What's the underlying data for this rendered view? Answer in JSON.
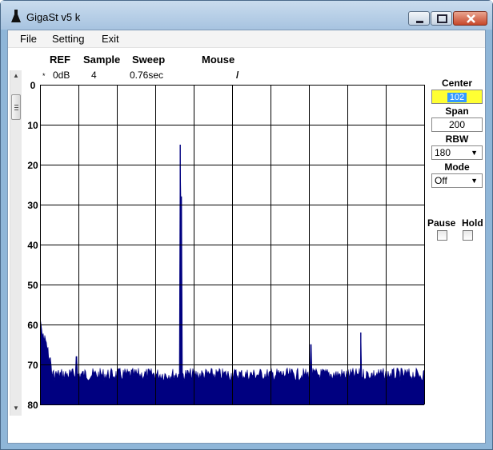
{
  "window": {
    "title": "GigaSt v5 k"
  },
  "menu": [
    "File",
    "Setting",
    "Exit"
  ],
  "header": {
    "ref_label": "REF",
    "sample_label": "Sample",
    "sweep_label": "Sweep",
    "mouse_label": "Mouse",
    "ref_marker": "*",
    "ref_value": "0dB",
    "sample_value": "4",
    "sweep_value": "0.76sec",
    "mouse_value": "/"
  },
  "y_axis": {
    "labels": [
      "0",
      "10",
      "20",
      "30",
      "40",
      "50",
      "60",
      "70",
      "80"
    ]
  },
  "controls": {
    "center_label": "Center",
    "center_value": "102",
    "span_label": "Span",
    "span_value": "200",
    "rbw_label": "RBW",
    "rbw_value": "180",
    "mode_label": "Mode",
    "mode_value": "Off",
    "pause_label": "Pause",
    "hold_label": "Hold"
  },
  "chart_data": {
    "type": "line",
    "ylim": [
      0,
      80
    ],
    "y_inverted": true,
    "xlim": [
      2,
      202
    ],
    "grid": true,
    "vertical_divisions": 10,
    "horizontal_divisions": 8,
    "trace_color": "#000080",
    "noise_floor": 72.5,
    "peaks": [
      {
        "x": 2,
        "y": 58
      },
      {
        "x": 21,
        "y": 68
      },
      {
        "x": 75,
        "y": 15
      },
      {
        "x": 75.5,
        "y": 28
      },
      {
        "x": 143,
        "y": 65
      },
      {
        "x": 169,
        "y": 62
      }
    ]
  },
  "colors": {
    "center_bg": "#ffff33",
    "trace": "#000080",
    "grid": "#000000"
  }
}
